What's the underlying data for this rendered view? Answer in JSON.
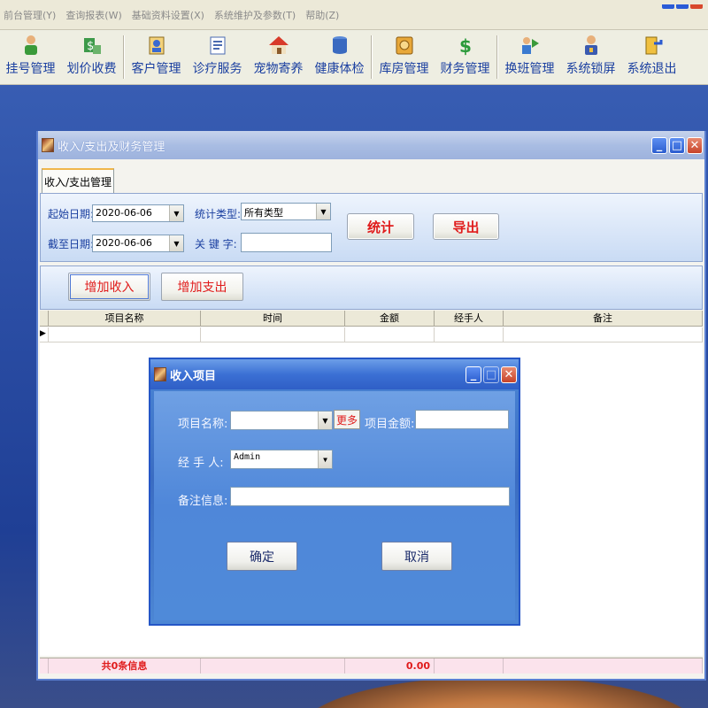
{
  "menu": [
    "前台管理(Y)",
    "查询报表(W)",
    "基础资料设置(X)",
    "系统维护及参数(T)",
    "帮助(Z)"
  ],
  "toolbar": [
    {
      "label": "挂号管理",
      "icon": "person-register-icon"
    },
    {
      "label": "划价收费",
      "icon": "money-icon"
    },
    {
      "label": "客户管理",
      "icon": "customer-icon"
    },
    {
      "label": "诊疗服务",
      "icon": "document-icon"
    },
    {
      "label": "宠物寄养",
      "icon": "house-icon"
    },
    {
      "label": "健康体检",
      "icon": "database-icon"
    },
    {
      "label": "库房管理",
      "icon": "warehouse-icon"
    },
    {
      "label": "财务管理",
      "icon": "dollar-icon"
    },
    {
      "label": "换班管理",
      "icon": "shift-icon"
    },
    {
      "label": "系统锁屏",
      "icon": "lock-icon"
    },
    {
      "label": "系统退出",
      "icon": "exit-icon"
    }
  ],
  "window": {
    "title": "收入/支出及财务管理",
    "tab": "收入/支出管理",
    "filters": {
      "start_label": "起始日期:",
      "start_value": "2020-06-06",
      "end_label": "截至日期:",
      "end_value": "2020-06-06",
      "type_label": "统计类型:",
      "type_value": "所有类型",
      "keyword_label": "关 键 字:",
      "keyword_value": ""
    },
    "stat_button": "统计",
    "export_button": "导出",
    "add_income_button": "增加收入",
    "add_expense_button": "增加支出",
    "columns": [
      "项目名称",
      "时间",
      "金额",
      "经手人",
      "备注"
    ],
    "footer_count": "共0条信息",
    "footer_total": "0.00"
  },
  "dialog": {
    "title": "收入项目",
    "item_name_label": "项目名称:",
    "item_name_value": "",
    "more_button": "更多",
    "amount_label": "项目金额:",
    "amount_value": "",
    "handler_label": "经 手 人:",
    "handler_value": "Admin",
    "note_label": "备注信息:",
    "note_value": "",
    "ok_button": "确定",
    "cancel_button": "取消"
  },
  "colors": {
    "accent_red": "#e01b1b",
    "label_blue": "#1a3fa0",
    "dialog_blue": "#4f87d9"
  }
}
